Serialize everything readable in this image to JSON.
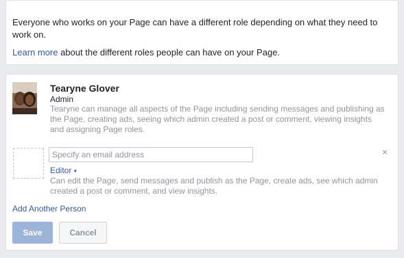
{
  "intro": {
    "text": "Everyone who works on your Page can have a different role depending on what they need to work on.",
    "learn_link": "Learn more",
    "learn_rest": " about the different roles people can have on your Page."
  },
  "admin": {
    "name": "Tearyne Glover",
    "role": "Admin",
    "description": "Tearyne can manage all aspects of the Page including sending messages and publishing as the Page, creating ads, seeing which admin created a post or comment, viewing insights and assigning Page roles."
  },
  "new_person": {
    "email_placeholder": "Specify an email address",
    "remove_icon": "×",
    "role_label": "Editor",
    "role_caret": "▾",
    "role_description": "Can edit the Page, send messages and publish as the Page, create ads, see which admin created a post or comment, and view insights."
  },
  "add_another": "Add Another Person",
  "buttons": {
    "save": "Save",
    "cancel": "Cancel"
  },
  "colors": {
    "link": "#365899",
    "save_disabled": "#9cb4d8",
    "muted": "#90949c"
  }
}
